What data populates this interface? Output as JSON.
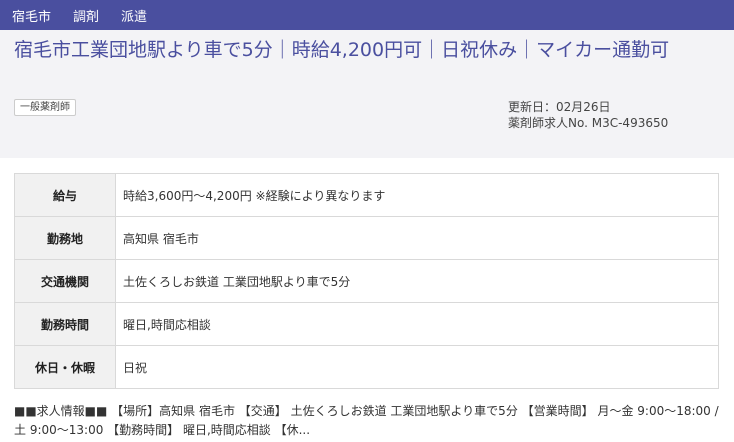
{
  "breadcrumb": [
    "宿毛市",
    "調剤",
    "派遣"
  ],
  "job": {
    "title": "宿毛市工業団地駅より車で5分｜時給4,200円可｜日祝休み｜マイカー通勤可",
    "badge": "一般薬剤師",
    "updated": "更新日：02月26日",
    "job_id": "薬剤師求人No. M3C-493650"
  },
  "details": [
    {
      "label": "給与",
      "value": "時給3,600円〜4,200円 ※経験により異なります"
    },
    {
      "label": "勤務地",
      "value": "高知県 宿毛市"
    },
    {
      "label": "交通機関",
      "value": "土佐くろしお鉄道 工業団地駅より車で5分"
    },
    {
      "label": "勤務時間",
      "value": "曜日,時間応相談"
    },
    {
      "label": "休日・休暇",
      "value": "日祝"
    }
  ],
  "summary": "■■求人情報■■ 【場所】高知県 宿毛市 【交通】 土佐くろしお鉄道 工業団地駅より車で5分 【営業時間】 月〜金 9:00〜18:00 / 土 9:00〜13:00 【勤務時間】 曜日,時間応相談 【休..."
}
